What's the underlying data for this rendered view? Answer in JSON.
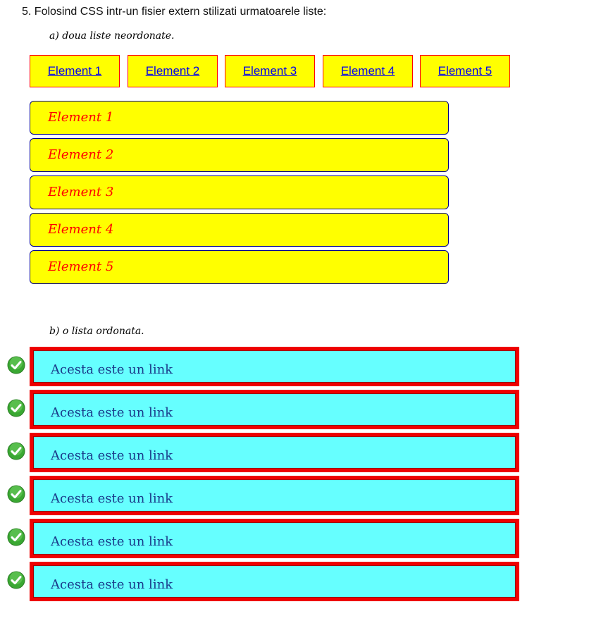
{
  "heading": "5. Folosind CSS intr-un fisier extern stilizati urmatoarele liste:",
  "section_a": {
    "title": "a) doua liste neordonate.",
    "horizontal_items": [
      "Element 1",
      "Element 2",
      "Element 3",
      "Element 4",
      "Element 5"
    ],
    "vertical_items": [
      "Element 1",
      "Element 2",
      "Element 3",
      "Element 4",
      "Element 5"
    ]
  },
  "section_b": {
    "title": "b) o lista ordonata.",
    "items": [
      "Acesta este un link",
      "Acesta este un link",
      "Acesta este un link",
      "Acesta este un link",
      "Acesta este un link",
      "Acesta este un link"
    ],
    "icon": "check-circle-icon"
  },
  "colors": {
    "yellow": "#ffff00",
    "red": "#ff0000",
    "cyan": "#66ffff",
    "link_blue": "#0000ee",
    "check_green": "#3aa832"
  }
}
